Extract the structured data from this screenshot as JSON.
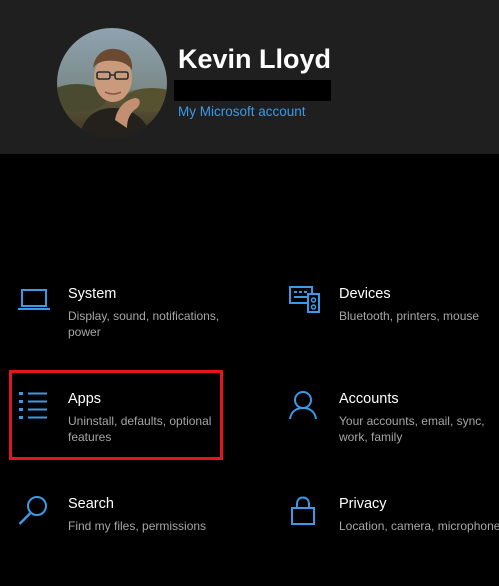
{
  "profile": {
    "name": "Kevin Lloyd",
    "account_link": "My Microsoft account"
  },
  "accent_color": "#3a9ae8",
  "highlight_color": "#e3171b",
  "categories": [
    {
      "title": "System",
      "description": "Display, sound, notifications, power",
      "icon": "laptop-icon"
    },
    {
      "title": "Devices",
      "description": "Bluetooth, printers, mouse",
      "icon": "devices-icon"
    },
    {
      "title": "Apps",
      "description": "Uninstall, defaults, optional features",
      "icon": "apps-list-icon",
      "highlighted": true
    },
    {
      "title": "Accounts",
      "description": "Your accounts, email, sync, work, family",
      "icon": "person-icon"
    },
    {
      "title": "Search",
      "description": "Find my files, permissions",
      "icon": "search-icon"
    },
    {
      "title": "Privacy",
      "description": "Location, camera, microphone",
      "icon": "lock-icon"
    }
  ]
}
